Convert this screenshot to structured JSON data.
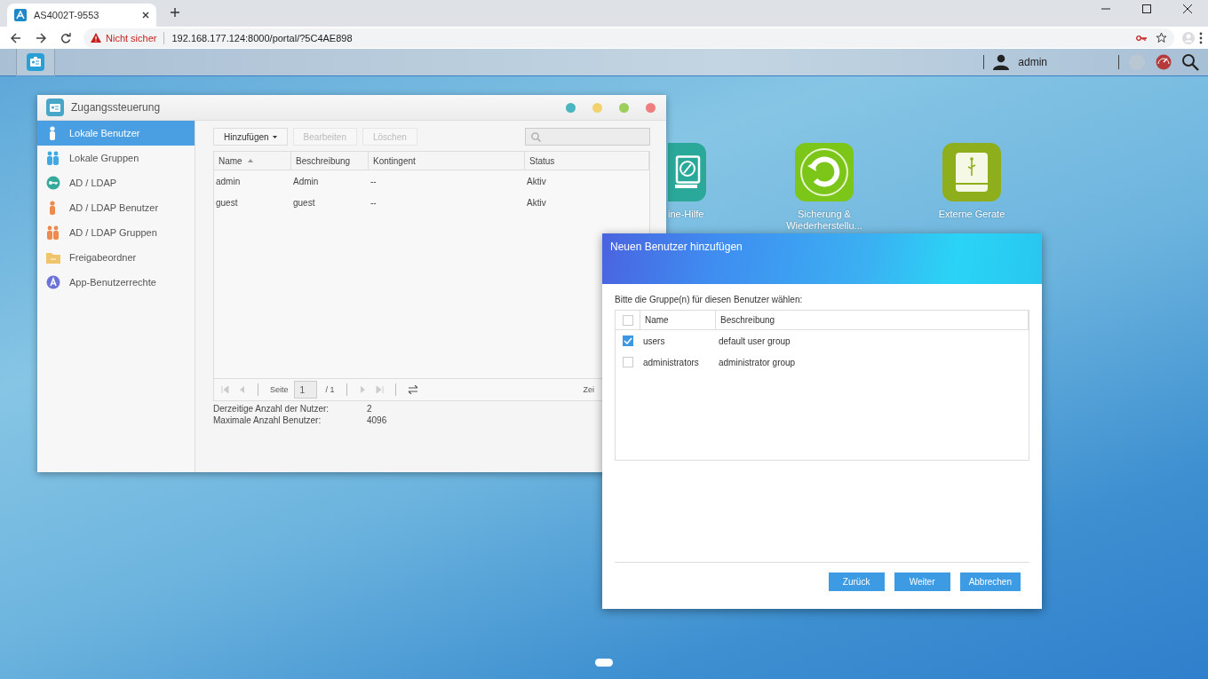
{
  "browser": {
    "tab_title": "AS4002T-9553",
    "security_label": "Nicht sicher",
    "url": "192.168.177.124:8000/portal/?5C4AE898"
  },
  "taskbar": {
    "user": "admin"
  },
  "desktop_icons": [
    {
      "kind": "help",
      "label": "ine-Hilfe"
    },
    {
      "kind": "backup",
      "label": "Sicherung & Wiederherstellu..."
    },
    {
      "kind": "external",
      "label": "Externe Gerate"
    }
  ],
  "window": {
    "title": "Zugangssteuerung",
    "sidebar": [
      {
        "label": "Lokale Benutzer",
        "selected": true
      },
      {
        "label": "Lokale Gruppen",
        "selected": false
      },
      {
        "label": "AD / LDAP",
        "selected": false
      },
      {
        "label": "AD / LDAP Benutzer",
        "selected": false
      },
      {
        "label": "AD / LDAP Gruppen",
        "selected": false
      },
      {
        "label": "Freigabeordner",
        "selected": false
      },
      {
        "label": "App-Benutzerrechte",
        "selected": false
      }
    ],
    "toolbar": [
      {
        "label": "Hinzufügen",
        "disabled": false,
        "menu": true
      },
      {
        "label": "Bearbeiten",
        "disabled": true,
        "menu": false
      },
      {
        "label": "Löschen",
        "disabled": true,
        "menu": false
      }
    ],
    "table": {
      "columns": [
        {
          "label": "Name",
          "sorted": true
        },
        {
          "label": "Beschreibung",
          "sorted": false
        },
        {
          "label": "Kontingent",
          "sorted": false
        },
        {
          "label": "Status",
          "sorted": false
        }
      ],
      "rows": [
        [
          "admin",
          "Admin",
          "--",
          "Aktiv"
        ],
        [
          "guest",
          "guest",
          "--",
          "Aktiv"
        ]
      ]
    },
    "pager": {
      "page_label": "Seite",
      "page": "1",
      "total": "/ 1",
      "trailing": "Zei"
    },
    "stats": [
      {
        "label": "Derzeitige Anzahl der Nutzer:",
        "value": "2"
      },
      {
        "label": "Maximale Anzahl Benutzer:",
        "value": "4096"
      }
    ]
  },
  "dialog": {
    "title": "Neuen Benutzer hinzufügen",
    "prompt": "Bitte die Gruppe(n) für diesen Benutzer wählen:",
    "table": {
      "all_checked": false,
      "columns": [
        "Name",
        "Beschreibung"
      ],
      "rows": [
        {
          "name": "users",
          "description": "default user group",
          "checked": true
        },
        {
          "name": "administrators",
          "description": "administrator group",
          "checked": false
        }
      ]
    },
    "buttons": [
      "Zurück",
      "Weiter",
      "Abbrechen"
    ]
  }
}
